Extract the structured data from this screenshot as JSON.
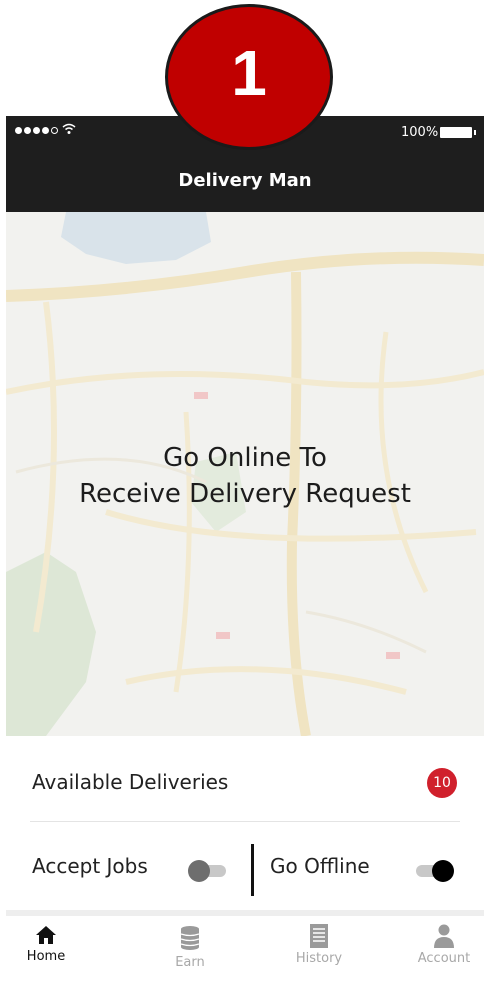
{
  "step_number": "1",
  "status_bar": {
    "battery_percent": "100%"
  },
  "header": {
    "title": "Delivery Man"
  },
  "map": {
    "message_line1": "Go Online To",
    "message_line2": "Receive Delivery Request"
  },
  "deliveries": {
    "label": "Available Deliveries",
    "count": "10"
  },
  "toggles": {
    "accept_jobs": {
      "label": "Accept Jobs",
      "state": "off"
    },
    "go_offline": {
      "label": "Go Offline",
      "state": "on"
    }
  },
  "tabs": [
    {
      "label": "Home",
      "icon": "home-icon",
      "active": true
    },
    {
      "label": "Earn",
      "icon": "coins-icon",
      "active": false
    },
    {
      "label": "History",
      "icon": "list-icon",
      "active": false
    },
    {
      "label": "Account",
      "icon": "user-icon",
      "active": false
    }
  ],
  "colors": {
    "accent": "#c00000",
    "badge": "#d0202c",
    "bar": "#1e1e1e"
  }
}
